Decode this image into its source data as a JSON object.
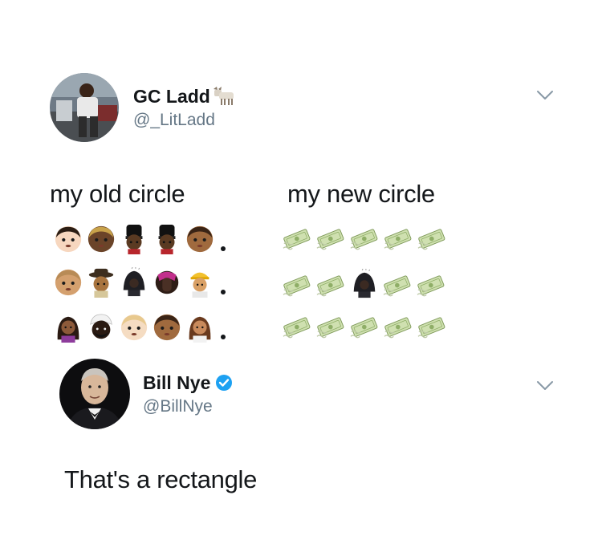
{
  "tweet1": {
    "display_name": "GC Ladd",
    "handle": "@_LitLadd",
    "name_icon": "goat-icon",
    "text_left": "my old circle",
    "text_right": "my new circle",
    "old_circle_rows": [
      [
        "face-light",
        "face-dark",
        "guard-dark",
        "guard-dark",
        "face-brown"
      ],
      [
        "face-tan",
        "detective-brown",
        "hooded-dark",
        "facepalm-dark",
        "builder-tan"
      ],
      [
        "woman-purple",
        "turban-dark",
        "face-pale",
        "face-brown",
        "woman-brown"
      ]
    ],
    "new_circle_rows": [
      [
        "money",
        "money",
        "money",
        "money",
        "money"
      ],
      [
        "money",
        "money",
        "hooded-dark",
        "money",
        "money"
      ],
      [
        "money",
        "money",
        "money",
        "money",
        "money"
      ]
    ]
  },
  "tweet2": {
    "display_name": "Bill Nye",
    "handle": "@BillNye",
    "verified_icon": "verified-badge-icon",
    "text": "That's a rectangle"
  },
  "colors": {
    "handle": "#657786",
    "verified": "#1da1f2",
    "text": "#14171a"
  }
}
